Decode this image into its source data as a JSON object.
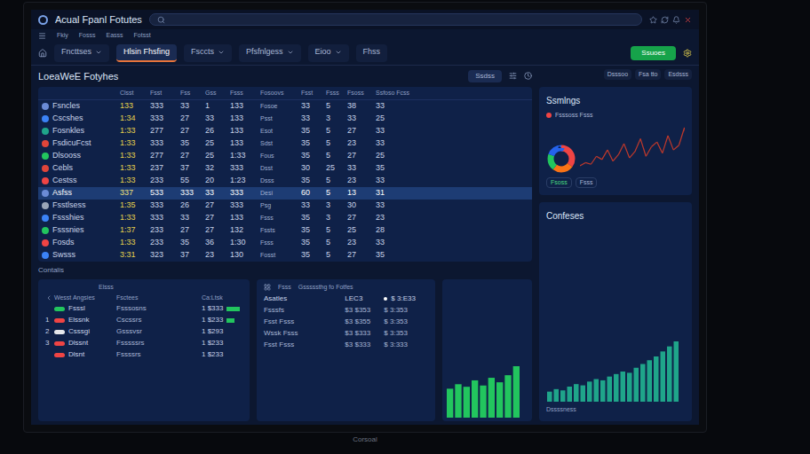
{
  "window": {
    "title": "Acual Fpanl Fotutes"
  },
  "menu": [
    "Fkiy",
    "Fosss",
    "Easss",
    "Fotsst"
  ],
  "tabs": [
    {
      "label": "Fncttses",
      "selected": false,
      "dropdown": true
    },
    {
      "label": "Hlsin Fhsfing",
      "selected": true,
      "dropdown": false
    },
    {
      "label": "Fsccts",
      "selected": false,
      "dropdown": true
    },
    {
      "label": "Pfsfnlgess",
      "selected": false,
      "dropdown": true
    },
    {
      "label": "Eioo",
      "selected": false,
      "dropdown": true
    },
    {
      "label": "Fhss",
      "selected": false,
      "dropdown": false
    }
  ],
  "toolbar_button": "Ssuoes",
  "section_title": "LoeaWeE Fotyhes",
  "table_action": "Ssdss",
  "table": {
    "columns": [
      "Clsst",
      "Fsst",
      "Fss",
      "Gss",
      "Fsss",
      "Fosoovs",
      "Fsst",
      "Fsss",
      "Fsoss",
      "Ssfoso Fcss"
    ],
    "rows": [
      {
        "name": "Fsncles",
        "color": "#6b8bd6",
        "selected": false,
        "cells": [
          "133",
          "333",
          "33",
          "1",
          "133",
          "Fosoe",
          "33",
          "5",
          "38",
          "33"
        ]
      },
      {
        "name": "Cscshes",
        "color": "#3b82f6",
        "selected": false,
        "cells": [
          "1:34",
          "333",
          "27",
          "33",
          "133",
          "Psst",
          "33",
          "3",
          "33",
          "25"
        ]
      },
      {
        "name": "Fosnkles",
        "color": "#1fa58a",
        "selected": false,
        "cells": [
          "1:33",
          "277",
          "27",
          "26",
          "133",
          "Esot",
          "35",
          "5",
          "27",
          "33"
        ]
      },
      {
        "name": "FsdicuFcst",
        "color": "#e0453a",
        "selected": false,
        "cells": [
          "1:33",
          "333",
          "35",
          "25",
          "133",
          "Sdst",
          "35",
          "5",
          "23",
          "33"
        ]
      },
      {
        "name": "Dlsooss",
        "color": "#22c55e",
        "selected": false,
        "cells": [
          "1:33",
          "277",
          "27",
          "25",
          "1:33",
          "Fous",
          "35",
          "5",
          "27",
          "25"
        ]
      },
      {
        "name": "Cebls",
        "color": "#e0453a",
        "selected": false,
        "cells": [
          "1:33",
          "237",
          "37",
          "32",
          "333",
          "Dsst",
          "30",
          "25",
          "33",
          "35"
        ]
      },
      {
        "name": "Cestss",
        "color": "#ef4444",
        "selected": false,
        "cells": [
          "1:33",
          "233",
          "55",
          "20",
          "1:23",
          "Dsss",
          "35",
          "5",
          "23",
          "33"
        ]
      },
      {
        "name": "Asfss",
        "color": "#6b8bd6",
        "selected": true,
        "cells": [
          "337",
          "533",
          "333",
          "33",
          "333",
          "Desi",
          "60",
          "5",
          "13",
          "31"
        ]
      },
      {
        "name": "Fsstlsess",
        "color": "#9aa5b8",
        "selected": false,
        "cells": [
          "1:35",
          "333",
          "26",
          "27",
          "333",
          "Psg",
          "33",
          "3",
          "30",
          "33"
        ]
      },
      {
        "name": "Fssshies",
        "color": "#3b82f6",
        "selected": false,
        "cells": [
          "1:33",
          "333",
          "33",
          "27",
          "133",
          "Fsss",
          "35",
          "3",
          "27",
          "23"
        ]
      },
      {
        "name": "Fsssnies",
        "color": "#22c55e",
        "selected": false,
        "cells": [
          "1:37",
          "233",
          "27",
          "27",
          "132",
          "Fssts",
          "35",
          "5",
          "25",
          "28"
        ]
      },
      {
        "name": "Fosds",
        "color": "#ef4444",
        "selected": false,
        "cells": [
          "1:33",
          "233",
          "35",
          "36",
          "1:30",
          "Fsss",
          "35",
          "5",
          "23",
          "33"
        ]
      },
      {
        "name": "Swsss",
        "color": "#3b82f6",
        "selected": false,
        "cells": [
          "3:31",
          "323",
          "37",
          "23",
          "130",
          "Fosst",
          "35",
          "5",
          "27",
          "35"
        ]
      }
    ]
  },
  "bottom_label": "Contalis",
  "ranking": {
    "title": "Elsss",
    "columns": [
      "Wesst Angsies",
      "Fsctees",
      "Ca:Ltsk"
    ],
    "rows": [
      {
        "index": "",
        "name": "Fsssl",
        "category": "Fsssosns",
        "value": "1 $333",
        "color": "#22c55e",
        "level": 0.6
      },
      {
        "index": "1",
        "name": "Elssnk",
        "category": "Cscssrs",
        "value": "1 $233",
        "color": "#ef4444",
        "level": 0.35
      },
      {
        "index": "2",
        "name": "Csssgi",
        "category": "Gsssvsr",
        "value": "1 $293",
        "color": "#e5e7eb",
        "level": 0
      },
      {
        "index": "3",
        "name": "Dlssnt",
        "category": "Fsssssrs",
        "value": "1 $233",
        "color": "#ef4444",
        "level": 0
      },
      {
        "index": "",
        "name": "Dlsnt",
        "category": "Fssssrs",
        "value": "1 $233",
        "color": "#ef4444",
        "level": 0
      }
    ]
  },
  "summary": {
    "title": "Fsss",
    "subtitle": "Gsssssthg fo Fotfes",
    "header": [
      "Asatles",
      "LEC3",
      "$ 3:E33"
    ],
    "rows": [
      [
        "Fsssfs",
        "$3 $353",
        "$ 3:353"
      ],
      [
        "Fsst Fsss",
        "$3 $355",
        "$ 3:353"
      ],
      [
        "Wssk Fsss",
        "$3 $333",
        "$ 3:353"
      ],
      [
        "Fsst Fsss",
        "$3 $333",
        "$ 3:333"
      ]
    ]
  },
  "mini_bars": [
    45,
    52,
    48,
    58,
    50,
    62,
    55,
    66,
    80
  ],
  "right_buttons": [
    "Dsssoo",
    "Fsa tto",
    "Esdsss"
  ],
  "samples": {
    "title": "Ssmlngs",
    "legend": "Fsssoss Fsss",
    "legend_color": "#ef4444",
    "donut": [
      {
        "value": 35,
        "color": "#ef4444"
      },
      {
        "value": 25,
        "color": "#f97316"
      },
      {
        "value": 20,
        "color": "#22c55e"
      },
      {
        "value": 20,
        "color": "#2563eb"
      }
    ],
    "series": [
      10,
      14,
      12,
      22,
      18,
      30,
      16,
      24,
      38,
      20,
      28,
      44,
      22,
      34,
      40,
      26,
      48,
      30,
      36,
      58,
      24,
      40
    ],
    "chips": [
      "Fsoss",
      "Fsss"
    ]
  },
  "confeses": {
    "title": "Confeses",
    "footer": "Dssssness",
    "series": [
      8,
      10,
      9,
      12,
      14,
      13,
      16,
      18,
      17,
      20,
      22,
      24,
      23,
      27,
      30,
      33,
      36,
      40,
      44,
      48
    ]
  },
  "brand": "Corsoal"
}
